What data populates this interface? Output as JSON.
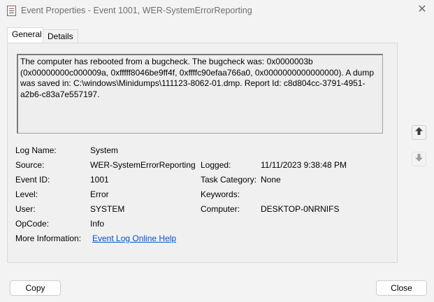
{
  "window": {
    "title": "Event Properties - Event 1001, WER-SystemErrorReporting",
    "close_glyph": "✕"
  },
  "tabs": [
    {
      "label": "General",
      "active": true
    },
    {
      "label": "Details",
      "active": false
    }
  ],
  "description": "The computer has rebooted from a bugcheck.  The bugcheck was: 0x0000003b (0x00000000c000009a, 0xfffff8046be9ff4f, 0xffffc90efaa766a0, 0x0000000000000000). A dump was saved in: C:\\windows\\Minidumps\\111123-8062-01.dmp. Report Id: c8d804cc-3791-4951-a2b6-c83a7e557197.",
  "fields": {
    "log_name": {
      "label": "Log Name:",
      "value": "System"
    },
    "source": {
      "label": "Source:",
      "value": "WER-SystemErrorReporting"
    },
    "logged": {
      "label": "Logged:",
      "value": "11/11/2023 9:38:48 PM"
    },
    "event_id": {
      "label": "Event ID:",
      "value": "1001"
    },
    "task_category": {
      "label": "Task Category:",
      "value": "None"
    },
    "level": {
      "label": "Level:",
      "value": "Error"
    },
    "keywords": {
      "label": "Keywords:",
      "value": ""
    },
    "user": {
      "label": "User:",
      "value": "SYSTEM"
    },
    "computer": {
      "label": "Computer:",
      "value": "DESKTOP-0NRNIFS"
    },
    "opcode": {
      "label": "OpCode:",
      "value": "Info"
    },
    "more_info": {
      "label": "More Information:",
      "link": "Event Log Online Help"
    }
  },
  "nav": {
    "up_icon": "arrow-up-icon",
    "down_icon": "arrow-down-icon"
  },
  "buttons": {
    "copy": "Copy",
    "close": "Close"
  }
}
